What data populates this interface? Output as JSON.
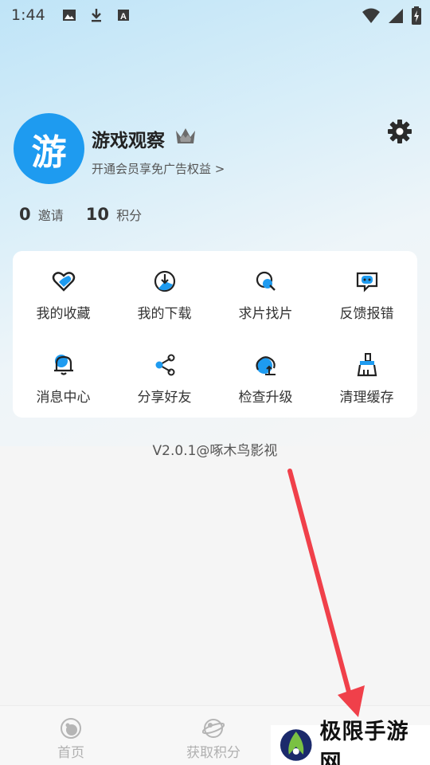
{
  "status_bar": {
    "time": "1:44",
    "icons": [
      "image-icon",
      "download-icon",
      "a-box-icon",
      "wifi-icon",
      "signal-icon",
      "battery-charging-icon"
    ]
  },
  "profile": {
    "avatar_text": "游",
    "username": "游戏观察",
    "vip_link": "开通会员享免广告权益 >",
    "crown_icon": "crown-icon",
    "settings_icon": "gear-icon"
  },
  "stats": {
    "invites_count": "0",
    "invites_label": "邀请",
    "points_count": "10",
    "points_label": "积分"
  },
  "menu": {
    "items": [
      {
        "label": "我的收藏",
        "icon": "heart-icon"
      },
      {
        "label": "我的下载",
        "icon": "download-circle-icon"
      },
      {
        "label": "求片找片",
        "icon": "search-icon"
      },
      {
        "label": "反馈报错",
        "icon": "feedback-icon"
      },
      {
        "label": "消息中心",
        "icon": "bell-icon"
      },
      {
        "label": "分享好友",
        "icon": "share-icon"
      },
      {
        "label": "检查升级",
        "icon": "upload-cloud-icon"
      },
      {
        "label": "清理缓存",
        "icon": "broom-icon"
      }
    ]
  },
  "version": "V2.0.1@啄木鸟影视",
  "tabbar": {
    "tabs": [
      {
        "label": "首页",
        "icon": "home-icon"
      },
      {
        "label": "获取积分",
        "icon": "points-icon"
      },
      {
        "label": "",
        "icon": "profile-icon"
      }
    ]
  },
  "watermark": {
    "text": "极限手游网"
  },
  "colors": {
    "accent": "#1e9bf0",
    "arrow": "#f0404a",
    "tab_inactive": "#b0b0b0"
  }
}
